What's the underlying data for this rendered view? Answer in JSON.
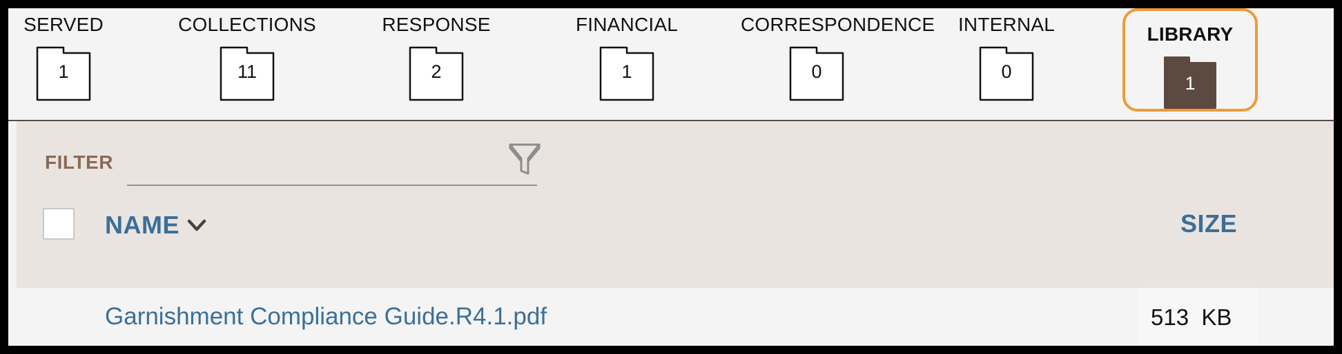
{
  "tabs": [
    {
      "label": "SERVED",
      "count": "1",
      "active": false
    },
    {
      "label": "COLLECTIONS",
      "count": "11",
      "active": false
    },
    {
      "label": "RESPONSE",
      "count": "2",
      "active": false
    },
    {
      "label": "FINANCIAL",
      "count": "1",
      "active": false
    },
    {
      "label": "CORRESPONDENCE",
      "count": "0",
      "active": false
    },
    {
      "label": "INTERNAL",
      "count": "0",
      "active": false
    },
    {
      "label": "LIBRARY",
      "count": "1",
      "active": true
    }
  ],
  "filter": {
    "label": "FILTER",
    "value": "",
    "placeholder": ""
  },
  "columns": {
    "name": "NAME",
    "size": "SIZE"
  },
  "rows": [
    {
      "name": "Garnishment Compliance Guide.R4.1.pdf",
      "size": "513  KB"
    }
  ],
  "colors": {
    "accent_active_ring": "#ee9b35",
    "active_folder": "#5c4a40",
    "link_blue": "#3b6f9a",
    "filter_label": "#8a6a57",
    "panel_bg": "#eae4e1"
  },
  "icons": {
    "folder": "folder-icon",
    "filter": "funnel-icon",
    "sort": "chevron-down-icon"
  }
}
